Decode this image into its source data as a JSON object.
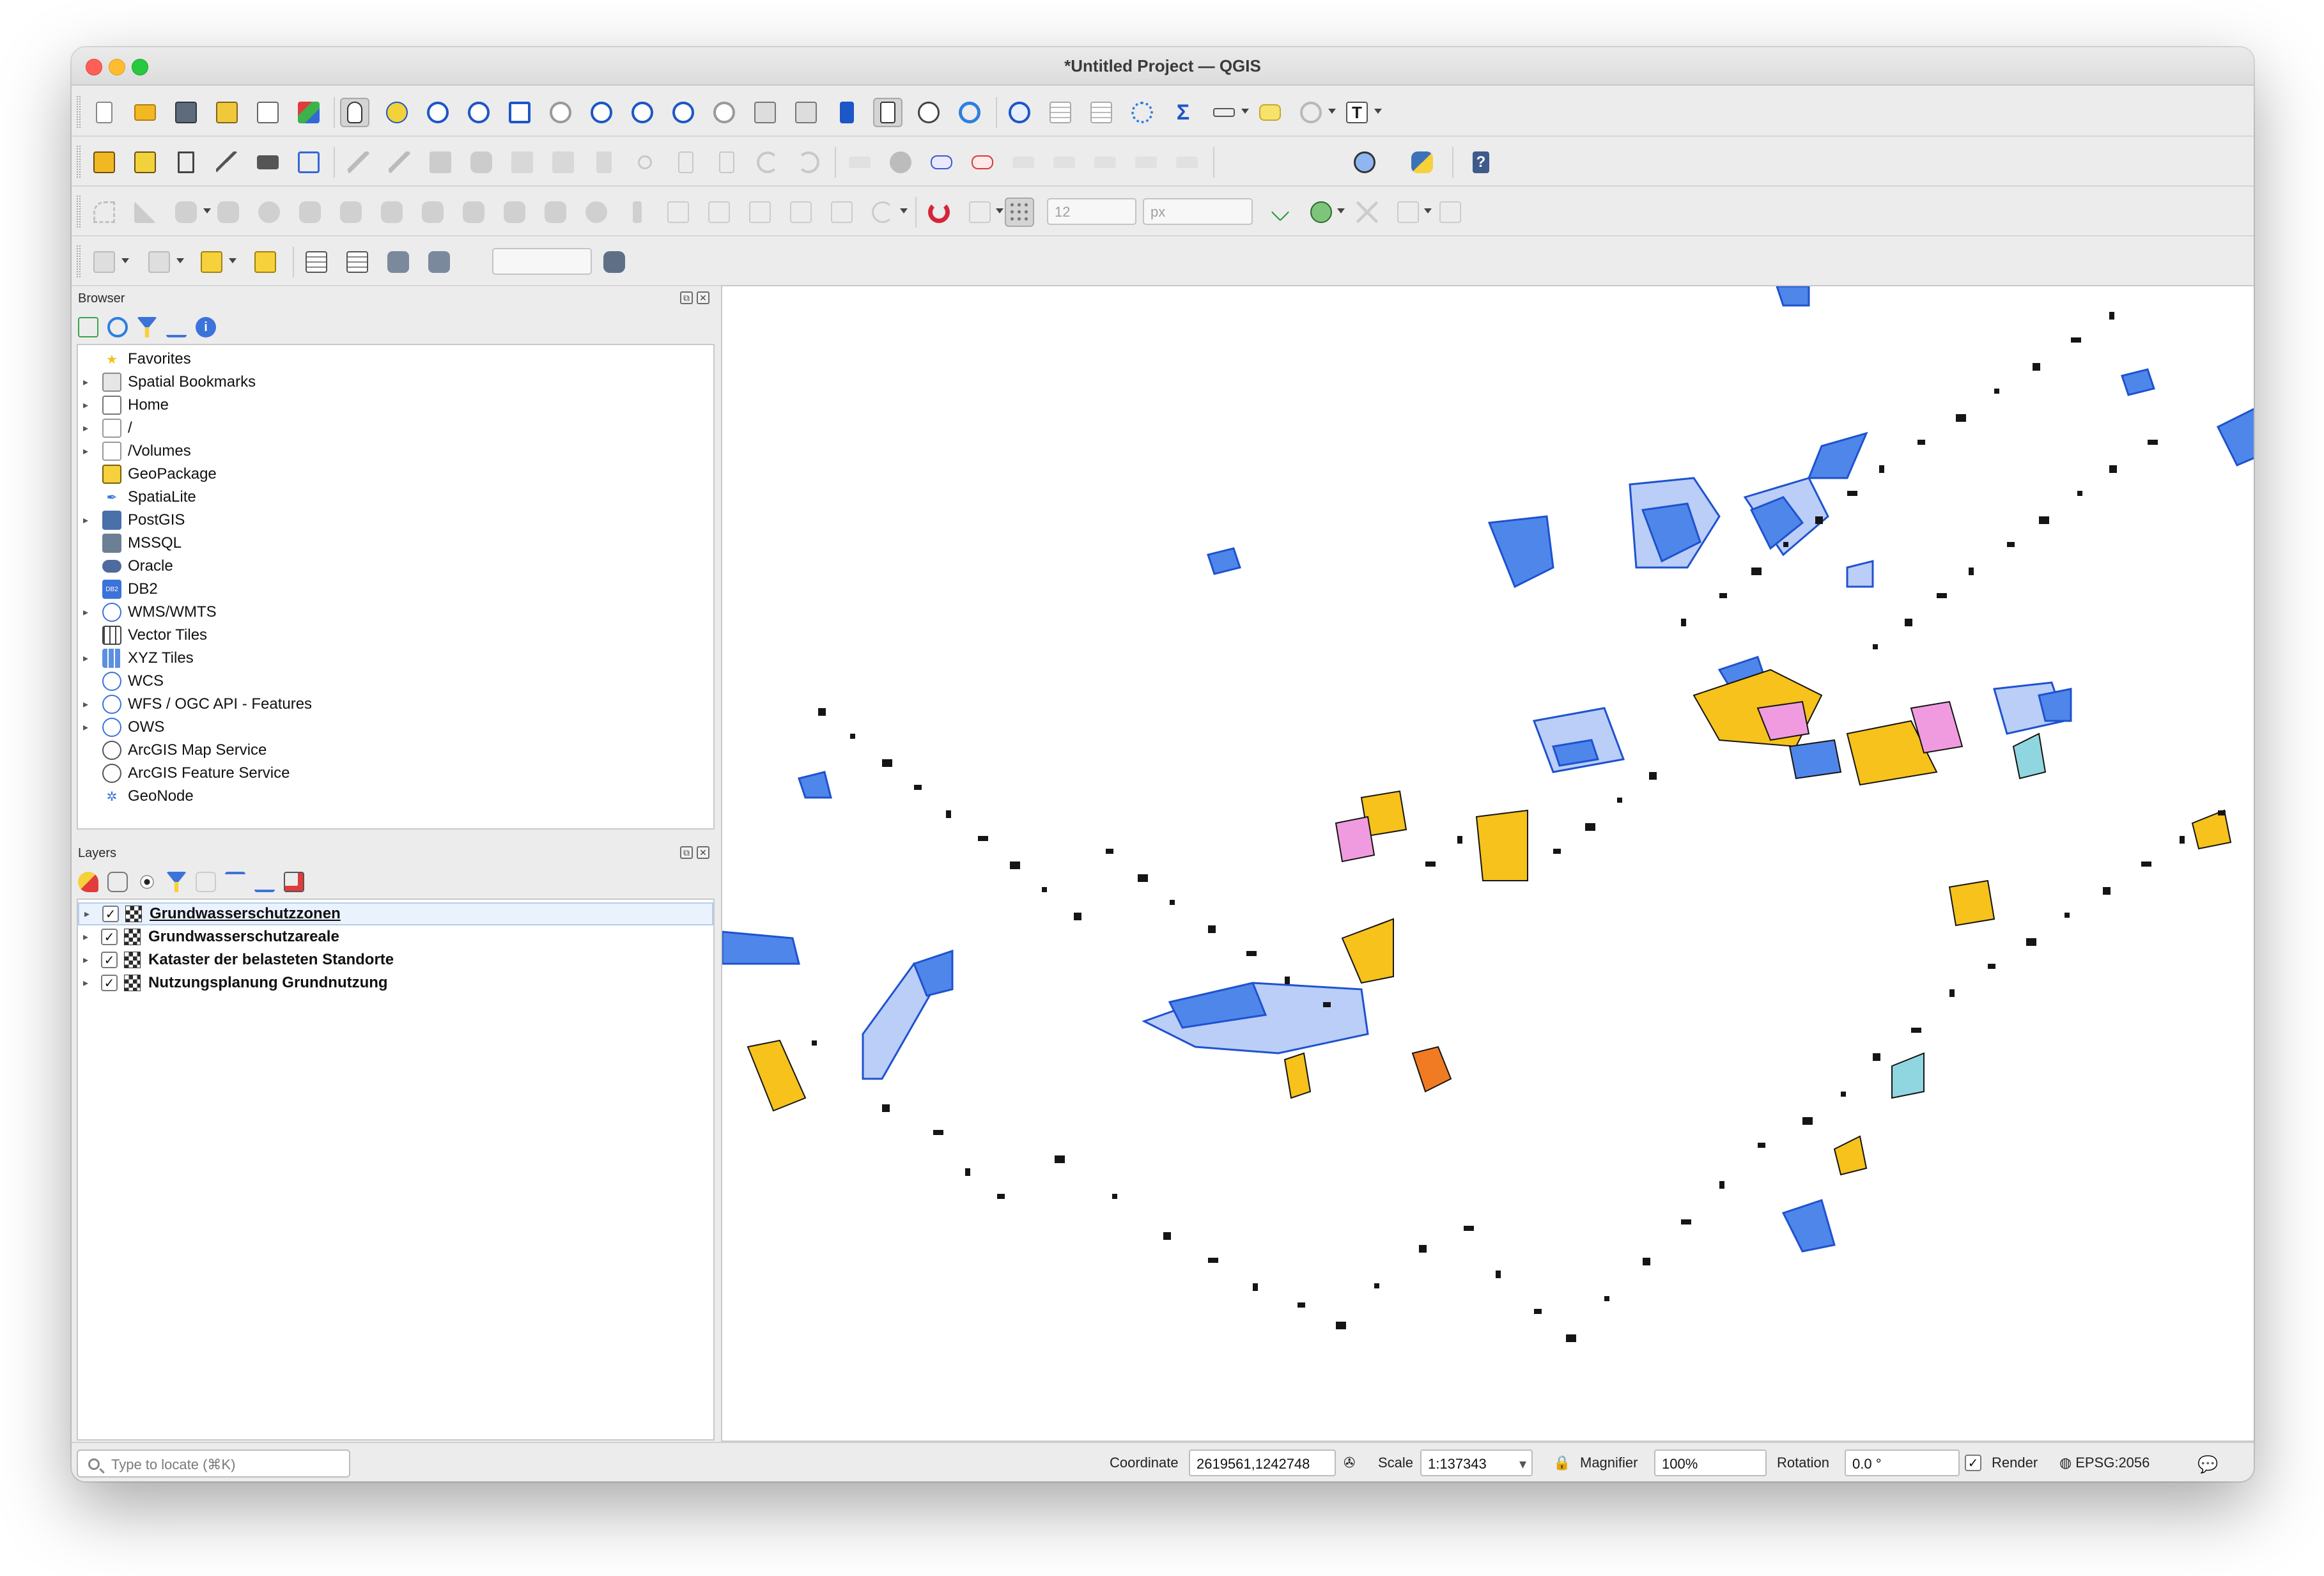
{
  "window": {
    "title": "*Untitled Project — QGIS"
  },
  "toolbars": {
    "row1": [
      "new-project",
      "open-project",
      "save-project",
      "save-as",
      "print-layout",
      "style-manager",
      "pan-map",
      "pan-to-selection",
      "zoom-in",
      "zoom-out",
      "zoom-full",
      "zoom-to-selection",
      "zoom-to-layer",
      "zoom-native",
      "zoom-last",
      "zoom-next",
      "new-map-view",
      "new-3d-view",
      "new-bookmark",
      "show-bookmarks",
      "temporal-controller",
      "refresh",
      "identify",
      "open-attribute-table",
      "field-calculator",
      "processing-toolbox",
      "statistics",
      "measure",
      "map-tips",
      "select-features",
      "text-annotation"
    ],
    "row2": [
      "data-source-manager",
      "new-geopackage-layer",
      "new-shapefile-layer",
      "new-spatialite-layer",
      "new-temp-layer",
      "digitize-toggle",
      "current-edits",
      "toggle-editing",
      "save-layer-edits",
      "add-feature",
      "vertex-tool",
      "modify-attributes",
      "delete-selected",
      "cut-features",
      "copy-features",
      "paste-features",
      "undo",
      "redo",
      "label-tool",
      "pin-labels",
      "highlight-labels",
      "show-hide-labels",
      "move-label",
      "rotate-label",
      "change-label",
      "qgis-plugins",
      "python-console",
      "help"
    ],
    "row3": [
      "add-circular-string",
      "add-ring",
      "add-part",
      "fill-ring",
      "delete-ring",
      "delete-part",
      "reshape",
      "offset-curve",
      "split-features",
      "split-parts",
      "merge-selected",
      "merge-attributes",
      "rotate-point-symbols",
      "snapping",
      "enable-tracing",
      "snapping-layers",
      "snapping-tolerance",
      "topological-editing",
      "self-snapping",
      "vertex-tool-all"
    ],
    "snap_tolerance_value": "12",
    "snap_units": "px",
    "row4": [
      "select-by-value",
      "deselect",
      "select-by-location",
      "add-to-selection",
      "attribute-table",
      "open-table",
      "db-manager",
      "sql-window"
    ]
  },
  "browser_panel": {
    "title": "Browser",
    "items": [
      {
        "label": "Favorites",
        "icon": "star-icon",
        "expandable": false
      },
      {
        "label": "Spatial Bookmarks",
        "icon": "bookmark-icon",
        "expandable": true
      },
      {
        "label": "Home",
        "icon": "home-folder-icon",
        "expandable": true
      },
      {
        "label": "/",
        "icon": "folder-icon",
        "expandable": true
      },
      {
        "label": "/Volumes",
        "icon": "folder-icon",
        "expandable": true
      },
      {
        "label": "GeoPackage",
        "icon": "geopackage-icon",
        "expandable": false
      },
      {
        "label": "SpatiaLite",
        "icon": "feather-icon",
        "expandable": false
      },
      {
        "label": "PostGIS",
        "icon": "elephant-icon",
        "expandable": true
      },
      {
        "label": "MSSQL",
        "icon": "mssql-icon",
        "expandable": false
      },
      {
        "label": "Oracle",
        "icon": "oracle-icon",
        "expandable": false
      },
      {
        "label": "DB2",
        "icon": "db2-icon",
        "expandable": false
      },
      {
        "label": "WMS/WMTS",
        "icon": "globe-icon",
        "expandable": true
      },
      {
        "label": "Vector Tiles",
        "icon": "grid-icon",
        "expandable": false
      },
      {
        "label": "XYZ Tiles",
        "icon": "tiles-icon",
        "expandable": true
      },
      {
        "label": "WCS",
        "icon": "globe-icon",
        "expandable": false
      },
      {
        "label": "WFS / OGC API - Features",
        "icon": "wfs-icon",
        "expandable": true
      },
      {
        "label": "OWS",
        "icon": "globe-icon",
        "expandable": true
      },
      {
        "label": "ArcGIS Map Service",
        "icon": "arcgis-icon",
        "expandable": false
      },
      {
        "label": "ArcGIS Feature Service",
        "icon": "arcgis-icon",
        "expandable": false
      },
      {
        "label": "GeoNode",
        "icon": "geonode-icon",
        "expandable": false
      }
    ]
  },
  "layers_panel": {
    "title": "Layers",
    "layers": [
      {
        "name": "Grundwasserschutzzonen",
        "checked": true,
        "selected": true
      },
      {
        "name": "Grundwasserschutzareale",
        "checked": true,
        "selected": false
      },
      {
        "name": "Kataster der belasteten Standorte",
        "checked": true,
        "selected": false
      },
      {
        "name": "Nutzungsplanung Grundnutzung",
        "checked": true,
        "selected": false
      }
    ]
  },
  "statusbar": {
    "locate_placeholder": "Type to locate (⌘K)",
    "coordinate_label": "Coordinate",
    "coordinate_value": "2619561,1242748",
    "scale_label": "Scale",
    "scale_value": "1:137343",
    "magnifier_label": "Magnifier",
    "magnifier_value": "100%",
    "rotation_label": "Rotation",
    "rotation_value": "0.0 °",
    "render_label": "Render",
    "render_checked": true,
    "crs_label": "EPSG:2056"
  },
  "map_colors": {
    "zone_light": "#a9c2f5",
    "zone_mid": "#4f86ea",
    "zone_dark": "#1f52cf",
    "zoning_yellow": "#f6c21b",
    "zoning_pink": "#f09be0",
    "zoning_orange": "#f07b23",
    "site_black": "#151515",
    "cyan": "#8fd6e0"
  }
}
